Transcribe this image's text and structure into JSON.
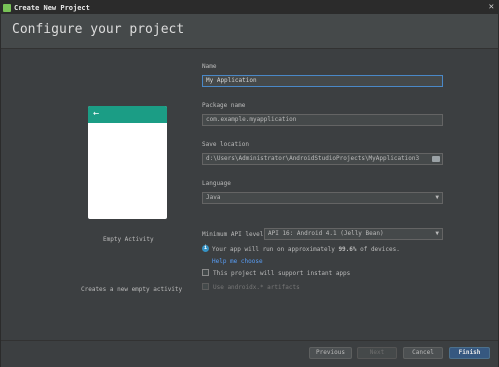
{
  "window": {
    "title": "Create New Project"
  },
  "header": {
    "title": "Configure your project"
  },
  "preview": {
    "back_icon": "←",
    "template_name": "Empty Activity",
    "description": "Creates a new empty activity"
  },
  "form": {
    "name": {
      "label": "Name",
      "value": "My Application"
    },
    "package": {
      "label": "Package name",
      "value": "com.example.myapplication"
    },
    "save_location": {
      "label": "Save location",
      "value": "d:\\Users\\Administrator\\AndroidStudioProjects\\MyApplication3"
    },
    "language": {
      "label": "Language",
      "value": "Java"
    },
    "min_api": {
      "label": "Minimum API level",
      "value": "API 16: Android 4.1 (Jelly Bean)"
    },
    "info": {
      "prefix": "Your app will run on approximately ",
      "percent": "99.6%",
      "suffix": " of devices.",
      "help_link": "Help me choose"
    },
    "instant_apps": {
      "label": "This project will support instant apps",
      "checked": false
    },
    "androidx": {
      "label": "Use androidx.* artifacts",
      "checked": false,
      "enabled": false
    }
  },
  "buttons": {
    "previous": "Previous",
    "next": "Next",
    "cancel": "Cancel",
    "finish": "Finish"
  }
}
